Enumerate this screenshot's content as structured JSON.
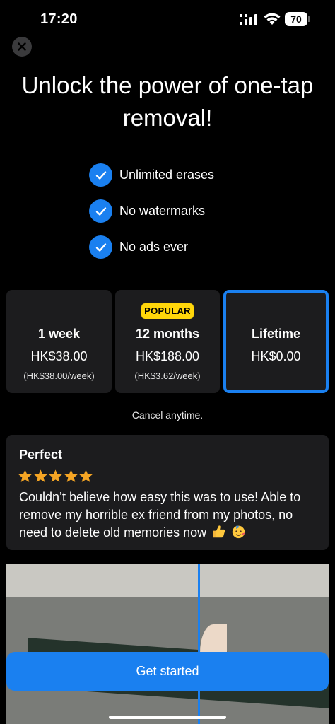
{
  "status_bar": {
    "time": "17:20",
    "battery_level": "70",
    "icons": [
      "signal-icon",
      "wifi-icon",
      "battery-icon"
    ]
  },
  "close_icon": "close-icon",
  "headline": "Unlock the power of one-tap removal!",
  "features": [
    {
      "label": "Unlimited erases",
      "icon": "checkmark-icon"
    },
    {
      "label": "No watermarks",
      "icon": "checkmark-icon"
    },
    {
      "label": "No ads ever",
      "icon": "checkmark-icon"
    }
  ],
  "plans": [
    {
      "name": "1 week",
      "price": "HK$38.00",
      "per": "(HK$38.00/week)",
      "selected": false
    },
    {
      "name": "12 months",
      "price": "HK$188.00",
      "per": "(HK$3.62/week)",
      "badge": "POPULAR",
      "selected": false
    },
    {
      "name": "Lifetime",
      "price": "HK$0.00",
      "selected": true
    }
  ],
  "cancel_note": "Cancel anytime.",
  "review": {
    "title": "Perfect",
    "rating": 5,
    "body": "Couldn’t believe how easy this was to use! Able to remove my horrible ex friend from my photos, no need to delete old memories now",
    "emojis": [
      "thumbs-up-icon",
      "party-face-icon"
    ]
  },
  "cta": {
    "label": "Get started"
  },
  "colors": {
    "accent": "#1a80f0",
    "badge": "#ffd60a",
    "star": "#f5a524",
    "card": "#1c1c1e"
  }
}
